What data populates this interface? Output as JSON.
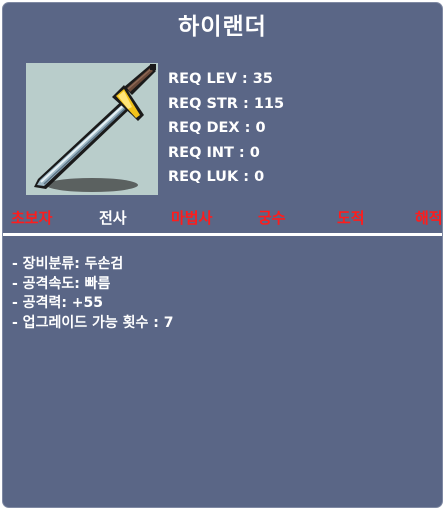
{
  "item": {
    "name": "하이랜더",
    "icon": "two-handed-sword-icon"
  },
  "requirements": [
    "REQ LEV : 35",
    "REQ STR : 115",
    "REQ DEX : 0",
    "REQ INT : 0",
    "REQ LUK : 0"
  ],
  "jobs": [
    {
      "label": "초보자",
      "color": "#ff1c1c"
    },
    {
      "label": "전사",
      "color": "#ffffff"
    },
    {
      "label": "마법사",
      "color": "#ff1c1c"
    },
    {
      "label": "궁수",
      "color": "#ff1c1c"
    },
    {
      "label": "도적",
      "color": "#ff1c1c"
    },
    {
      "label": "해적",
      "color": "#ff1c1c"
    }
  ],
  "stats": [
    "- 장비분류: 두손검",
    "- 공격속도: 빠름",
    "- 공격력: +55",
    "- 업그레이드 가능 횟수 : 7"
  ],
  "colors": {
    "panel": "#5a6686",
    "image_bg": "#b9cdcb",
    "disabled_job": "#ff1c1c",
    "enabled_job": "#ffffff"
  }
}
